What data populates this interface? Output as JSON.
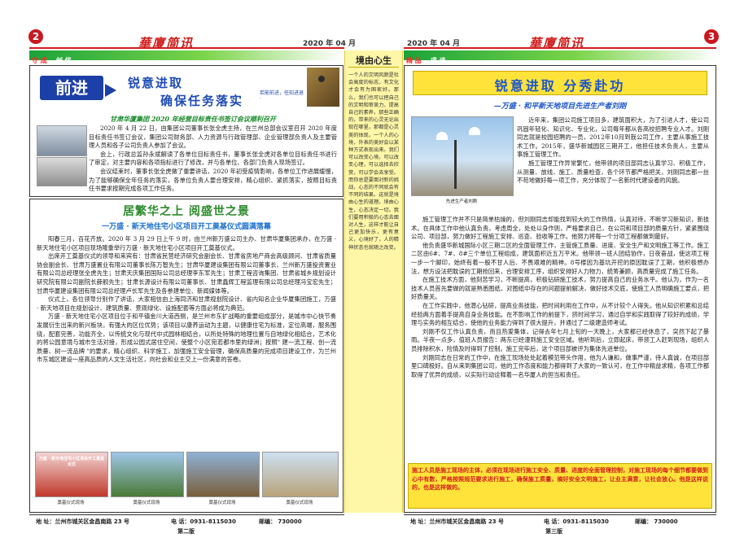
{
  "left_page": {
    "badge": "2",
    "header_title": "華廈简讯",
    "date": "2020 年 04 月",
    "section_tags": [
      "守 成",
      "创 优"
    ],
    "article1": {
      "logo_text": "前进",
      "slogan_line1": "锐意进取",
      "slogan_line2": "确保任务落实",
      "slogan_small": "若能前进，任知进退 ·",
      "subtitle": "甘肃华厦集团 2020 年经营目标责任书签订会议顺利召开",
      "paragraphs": [
        "2020 年 4 月 22 日，由集团公司董事长张全虎主持，在兰州总部会议室召开 2020 年度目标责任书签订会议，集团公司财务部、人力资源与行政管理部、企业管理部负责人及主要管理人员和各子公司负责人参加了会议。",
        "会上，行政总监孙永斌解读了各单位目标责任书，董事长张全虎对各单位目标责任书进行了审定，对主要内容和各项指标进行了修改，并与各单位、各部门负责人现场签订。",
        "会议结束时，董事长张全虎做了重要讲话，2020 年初受疫情影响，各单位工作进展缓慢，为了能够确保全年任务的落实，各单位负责人要合理安排，精心组织、紧抓落实，按照目标责任书要求按期完成各项工作任务。"
      ]
    },
    "article2": {
      "headline": "居繁华之上  阅盛世之景",
      "subhead": "一万盛 · 新天地住宅小区项目开工奠基仪式圆满落幕",
      "paragraphs": [
        "阳春三月，百花齐放。2020 年 3 月 29 日上午 9 时，由兰州新万盛公司主办、甘肃华厦集团承办，在万盛 · 新天地住宅小区项目现场隆重举行万盛 · 新天地住宅小区项目开工奠基仪式。",
        "出席开工奠基仪式的领导和来宾有：甘肃省民营经济研究会副会长、甘肃省房地产商会高级顾问、甘肃省质量协会副会长、甘肃万盛置业有限公司董事长陈万智先生；甘肃华厦建设集团有限公司董事长、兰州新万盛投资置业有限公司总经理张全虎先生；甘肃天庆集团国际公司总经理李东军先生；甘肃工程咨询集团、甘肃省城乡规划设计研究院有限公司副院长薛舰先生；甘肃长源设计有限公司董事长、甘肃鑫辉工程监理有限公司总经理冯宝宏先生；甘肃华厦建设集团有限公司总经理卢长军先生及各参建单位、新闻媒体等。",
        "仪式上，各位领导分别作了讲话，大家相信由上海同济和甘肃规划院设计、省内知名企业华厦集团施工，万盛 · 新天地项目在规划设计、建筑质量、景观绿化、设施配套等方面必将成为典范。",
        "万盛 · 新天地住宅小区项目位于和平镇金川大道西侧，是兰州市东扩战略的重要组成部分，是城市中心快节奏发展衍生出来的新兴板块，有强大的区位优势；该项目以康养运动为主题，以健康住宅为标准，定位高端，服务围绕，配套完善，功能齐全，以传统文化与现代中式园林相结合，以所处特殊的地理位置与自地绿化相结合，艺术化的将公园意境与城市生活对接，形成公园式居住空间，使整个小区宛若都市里的绿洲；按照\" 建一流工程、创一流质量、树一流品牌 \"的要求，精心组织、科学施工，加强施工安全管理，确保高质量的完成项目建设工作，为兰州市东城区建设一座高品质的人文生活社区，向社会和业主交上一份满意的答卷。"
      ],
      "photo_captions": [
        "奠基仪式现场",
        "奠基仪式现场",
        "奠基仪式现场",
        "奠基仪式现场"
      ],
      "banner_photo_text": "万盛 · 新天地住宅小区项目开工奠基仪式"
    },
    "footer": {
      "address": "地 址：兰州市城关区金昌南路 23 号",
      "phone": "电 话：0931-8115030",
      "postcode": "邮编：  730000",
      "page_label": "第二版"
    }
  },
  "middle_column": {
    "title": "境由心生",
    "text": "一个人的文明风貌是社会高度的标志，有文化才会有为国家好。那么，我们也可以把自己的文明和审美力，提高自己的素养，那些正确的，带来的心灵无论出现在哪里，那都是心灵美的体现，一个人的心境，外表的美好会以某种方式表现出来。我们可以改变心境，可以改变心理，可以选择去欣赏，可以学会去享受。而你总是要面对新的挑战，心态的不同就会有不同的结果。这就是境由心生的道理。境由心生，心态决定一切。我们要用积极的心态去面对人生，这样才能让自己更加快乐，更有意义，心境好了，人的精神状态也就随之改变。"
  },
  "right_page": {
    "badge": "3",
    "header_title": "華廈简讯",
    "date": "2020 年 04 月",
    "section_tags": [
      "精 品",
      "求 谈"
    ],
    "headline": "锐意进取   分秀赴功",
    "subhead": "—万盛 · 和平新天地项目先进生产者刘刚",
    "photo_caption": "先进生产者刘刚",
    "paragraphs": [
      "近年来，集团公司施工项目多，建筑面积大，为了引进人才，使公司巩固年轻化、知识化、专业化，公司每年都从各高校招聘专业人才。刘刚同志就是校园招聘的一员，2012年10月到我公司工作，主要从事施工技术工作。2015年，盛华新城园区三期开工，他担任技术负责人，主要从事施工管理工作。",
      "施工管理工作异常繁忙，他带领的项目部同志认真学习、积极工作，从测量、放线、施工、质量检查，各个环节都严格把关，刘刚同志都一丝不苟地做好每一项工作，充分体现了一名新时代建设者的风貌。",
      "施工管理工作并不只是简单枯燥的，但刘刚同志却能找到较大的工作热情，认真对待，不断学习新知识，新技术。在具体工作中他认真负责，考虑周全，处处以身作则，严格要求自己，在公司和项目部的质量方针，紧紧围绕公司、项目部，努力做好工程施工安排、巡查、验收等工作。他努力将每一个分项工程都做到最好。",
      "他负责盛华新城国际小区三期二区的全面管理工作，主管施工质量、进度、安全生产和文明施工等工作。施工二区由6#、7#、8#三个单位工程组成，建筑面积近五万平米。他带领一班人团结协作，日夜奋战，使这项工程一步一个脚印，始终有着一股不甘人后、不畏艰难的精神。8号楼因为基坑开挖的原因耽误了工期，他积极想办法，想方设法把耽误的工期抢回来，合理安排工序，组织安排好人力物力，统筹兼顾，高质量完成了施工任务。",
      "在施工技术方面，他刻苦学习，不断提高，积极钻研施工技术，努力提高自己的业务水平。他认为，作为一名技术人员首先要做的就是熟悉图纸，对图纸中存在的问题提前解决，做好技术交底，使施工人员明确施工要点，把好质量关。",
      "在工作实践中，他潜心钻研，提高业务技能，把时间利用在工作中，从不计较个人得失。他从知识积累和总结经验两方面着手提高自身业务技能。在不影响工作的前提下，挤时间学习，通过自学和实践取得了较好的成绩，学理与实务的相互结合，使他的业务能力得到了很大提升，并通过了二级建造师考试。",
      "刘刚不仅工作认真负责，而且热爱集体，记得去年七月上旬的一天晚上，大家都已经休息了，突然下起了暴雨。半夜一点多，值班人员报告：两东已经漫到施工安全区域。他听到后，立即起床，带领工人赶到现场，组织人员排除积水，险情及时得到了控制。施工完毕后，这个项目部被评为集体先进单位。",
      "刘刚同志在日常的工作中，在施工现场处处起着模范带头作用，他为人谦和，做事严谨，待人真诚，在项目部里口碑极好。自从来到集团公司，他的工作态度和能力都得到了大家的一致认可，在工作中精益求精，各项工作都取得了优异的成绩，以实际行动诠释着一名华厦人的担当和责任。"
    ],
    "highlight": "施工人员是施工现场的主体，必须在现场进行施工安全、质量、进度的全面管理控制，对施工现场的每个细节都要做到心中有数，严格按照规范要求进行施工，确保施工质量，搞好安全文明施工，让业主满意，让社会放心。他是这样说的，也是这样做的。",
    "footer": {
      "address": "地 址：兰州市城关区金昌南路 23 号",
      "phone": "电 话：0931-8115030",
      "postcode": "邮编：  730000",
      "page_label": "第三版"
    }
  }
}
